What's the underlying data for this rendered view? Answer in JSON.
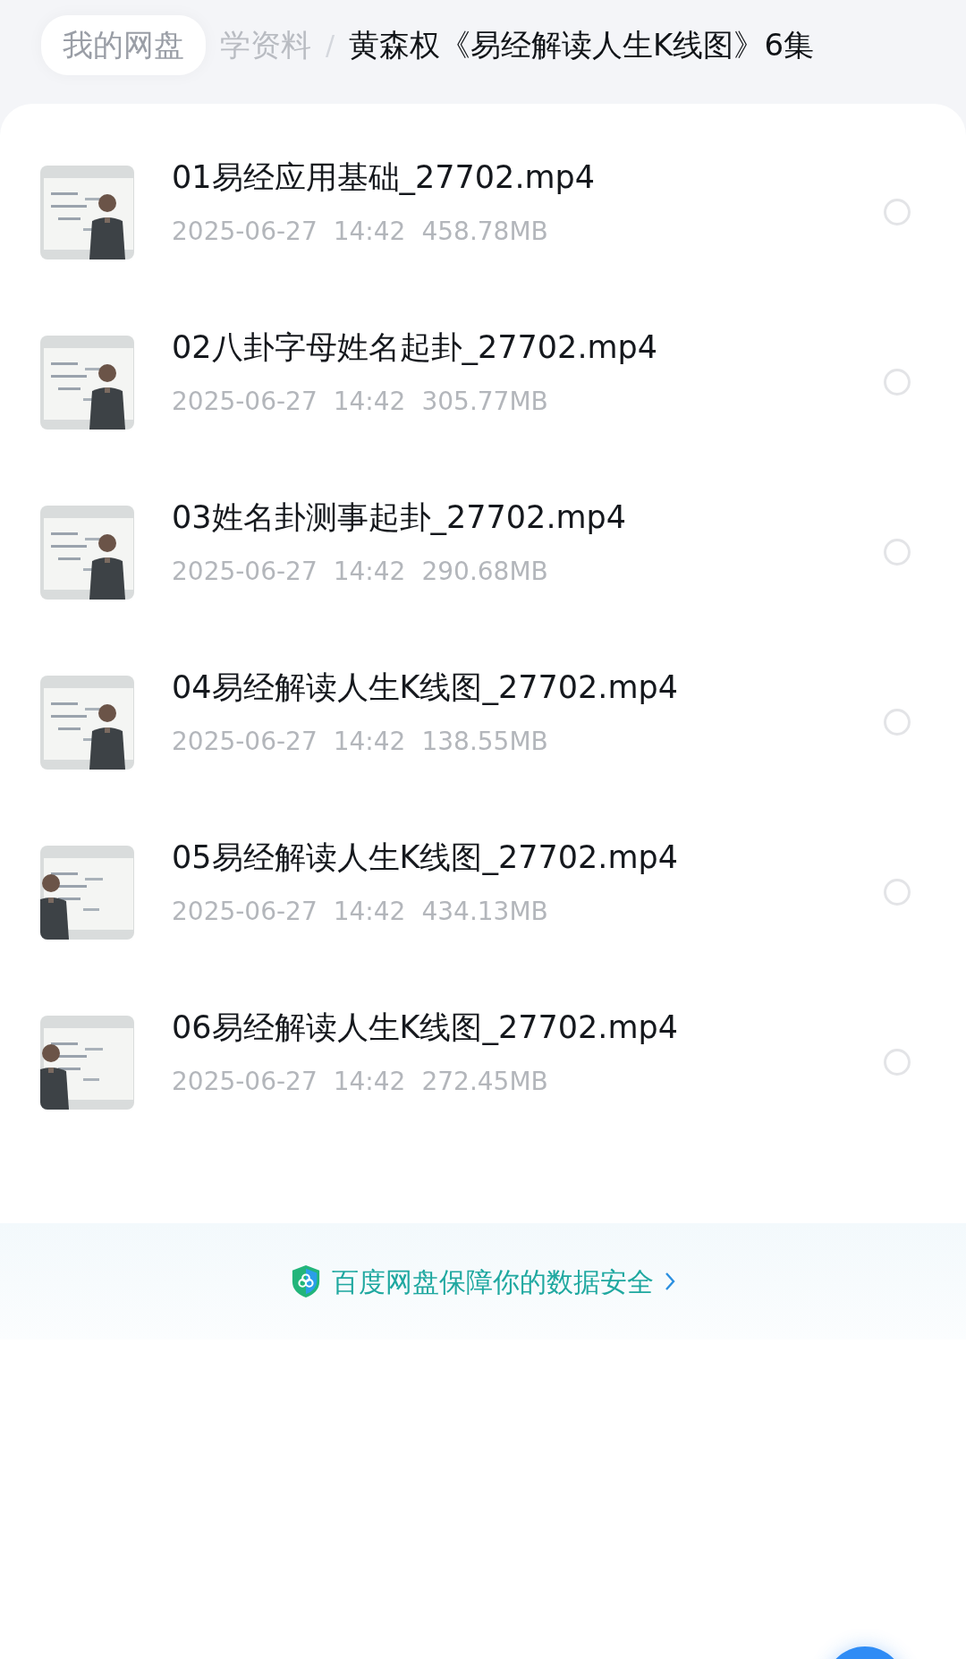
{
  "breadcrumb": [
    {
      "label": "我的网盘"
    },
    {
      "label": "学资料"
    },
    {
      "label": "黄森权《易经解读人生K线图》6集",
      "separator": "/"
    }
  ],
  "files": [
    {
      "name": "01易经应用基础_27702.mp4",
      "date": "2025-06-27",
      "time": "14:42",
      "size": "458.78MB",
      "selected": false
    },
    {
      "name": "02八卦字母姓名起卦_27702.mp4",
      "date": "2025-06-27",
      "time": "14:42",
      "size": "305.77MB",
      "selected": false
    },
    {
      "name": "03姓名卦测事起卦_27702.mp4",
      "date": "2025-06-27",
      "time": "14:42",
      "size": "290.68MB",
      "selected": false
    },
    {
      "name": "04易经解读人生K线图_27702.mp4",
      "date": "2025-06-27",
      "time": "14:42",
      "size": "138.55MB",
      "selected": false
    },
    {
      "name": "05易经解读人生K线图_27702.mp4",
      "date": "2025-06-27",
      "time": "14:42",
      "size": "434.13MB",
      "selected": false
    },
    {
      "name": "06易经解读人生K线图_27702.mp4",
      "date": "2025-06-27",
      "time": "14:42",
      "size": "272.45MB",
      "selected": false
    }
  ],
  "banner": {
    "text": "百度网盘保障你的数据安全"
  }
}
